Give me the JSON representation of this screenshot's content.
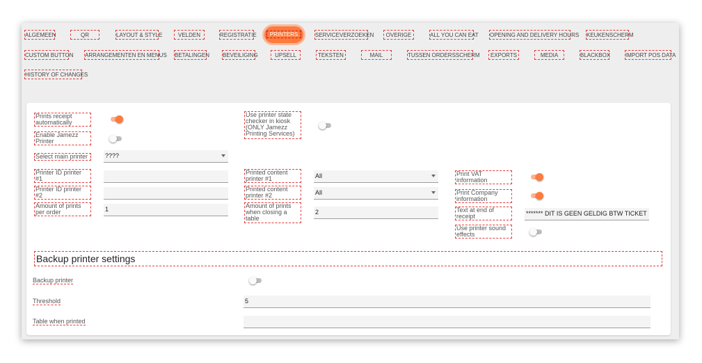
{
  "tabs_row1": [
    "ALGEMEEN",
    "QR",
    "LAYOUT & STYLE",
    "VELDEN",
    "REGISTRATIE",
    "PRINTERS",
    "SERVICEVERZOEKEN",
    "OVERIGE",
    "ALL YOU CAN EAT",
    "OPENING AND DELIVERY HOURS",
    "KEUKENSCHERM"
  ],
  "tabs_row2": [
    "CUSTOM BUTTON",
    "ARRANGEMENTEN EN MENUS",
    "BETALINGEN",
    "BEVEILIGING",
    "UPSELL",
    "TEKSTEN",
    "MAIL",
    "TUSSEN ORDERSSCHERM",
    "EXPORTS",
    "MEDIA",
    "BLACKBOX",
    "IMPORT POS DATA"
  ],
  "tabs_row3": [
    "HISTORY OF CHANGES"
  ],
  "active_tab": "PRINTERS",
  "left": {
    "prints_receipt_label": "Prints receipt automatically",
    "prints_receipt_on": true,
    "enable_jamezz_label": "Enable Jamezz Printer",
    "enable_jamezz_on": false,
    "main_printer_label": "Select main printer",
    "main_printer_value": "????",
    "printer_id_1_label": "Printer ID printer #1",
    "printer_id_1_value": "",
    "printer_id_2_label": "Printer ID printer #2",
    "printer_id_2_value": "",
    "amount_prints_label": "Amount of prints per order",
    "amount_prints_value": "1"
  },
  "middle": {
    "state_checker_label": "Use printer state checker in kiosk (ONLY Jamezz Printing Services)",
    "state_checker_on": false,
    "content_1_label": "Printed content printer #1",
    "content_1_value": "All",
    "content_2_label": "Printed content printer #2",
    "content_2_value": "All",
    "closing_table_label": "Amount of prints when closing a table",
    "closing_table_value": "2"
  },
  "right": {
    "vat_label": "Print VAT information",
    "vat_on": true,
    "company_label": "Print Company information",
    "company_on": true,
    "text_end_label": "Text at end of receipt",
    "text_end_value": "******* DIT IS GEEN GELDIG BTW TICKET",
    "sound_label": "Use printer sound effects",
    "sound_on": false
  },
  "backup": {
    "title": "Backup printer settings",
    "backup_label": "Backup printer",
    "backup_on": false,
    "threshold_label": "Threshold",
    "threshold_value": "5",
    "table_label": "Table when printed",
    "table_value": ""
  },
  "colors": {
    "accent": "#ff7a3d",
    "accent_light": "#ffb28e",
    "border_red": "#e03a3a"
  }
}
